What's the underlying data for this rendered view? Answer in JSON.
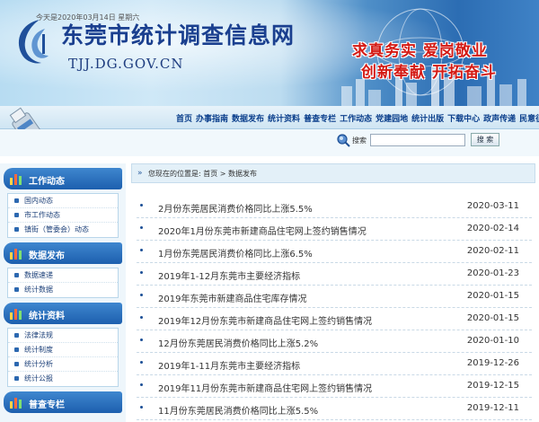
{
  "header": {
    "site_title": "东莞市统计调查信息网",
    "site_url": "TJJ.DG.GOV.CN",
    "slogan_line1": "求真务实 爱岗敬业",
    "slogan_line2": "创新奉献 开拓奋斗"
  },
  "nav": {
    "items": [
      "首页",
      "办事指南",
      "数据发布",
      "统计资料",
      "普查专栏",
      "工作动态",
      "党建园地",
      "统计出版",
      "下载中心",
      "政声传递",
      "民意征集"
    ]
  },
  "toolbar": {
    "date_text": "今天是2020年03月14日 星期六",
    "search_label": "搜索",
    "search_value": "",
    "search_button": "搜 索"
  },
  "sidebar": {
    "sections": [
      {
        "title": "工作动态",
        "items": [
          "国内动态",
          "市工作动态",
          "镇街（管委会）动态"
        ]
      },
      {
        "title": "数据发布",
        "items": [
          "数据速递",
          "统计数据"
        ]
      },
      {
        "title": "统计资料",
        "items": [
          "法律法规",
          "统计制度",
          "统计分析",
          "统计公报"
        ]
      },
      {
        "title": "普查专栏",
        "items": []
      }
    ]
  },
  "breadcrumb": {
    "prefix": "您现在的位置是:",
    "home": "首页",
    "separator": ">",
    "current": "数据发布"
  },
  "news": [
    {
      "title": "2月份东莞居民消费价格同比上涨5.5%",
      "date": "2020-03-11"
    },
    {
      "title": "2020年1月份东莞市新建商品住宅网上签约销售情况",
      "date": "2020-02-14"
    },
    {
      "title": "1月份东莞居民消费价格同比上涨6.5%",
      "date": "2020-02-11"
    },
    {
      "title": "2019年1-12月东莞市主要经济指标",
      "date": "2020-01-23"
    },
    {
      "title": "2019年东莞市新建商品住宅库存情况",
      "date": "2020-01-15"
    },
    {
      "title": "2019年12月份东莞市新建商品住宅网上签约销售情况",
      "date": "2020-01-15"
    },
    {
      "title": "12月份东莞居民消费价格同比上涨5.2%",
      "date": "2020-01-10"
    },
    {
      "title": "2019年1-11月东莞市主要经济指标",
      "date": "2019-12-26"
    },
    {
      "title": "2019年11月份东莞市新建商品住宅网上签约销售情况",
      "date": "2019-12-15"
    },
    {
      "title": "11月份东莞居民消费价格同比上涨5.5%",
      "date": "2019-12-11"
    }
  ],
  "colors": {
    "accent": "#1d5fae",
    "title": "#1a3f8f",
    "slogan": "#d41a14"
  }
}
